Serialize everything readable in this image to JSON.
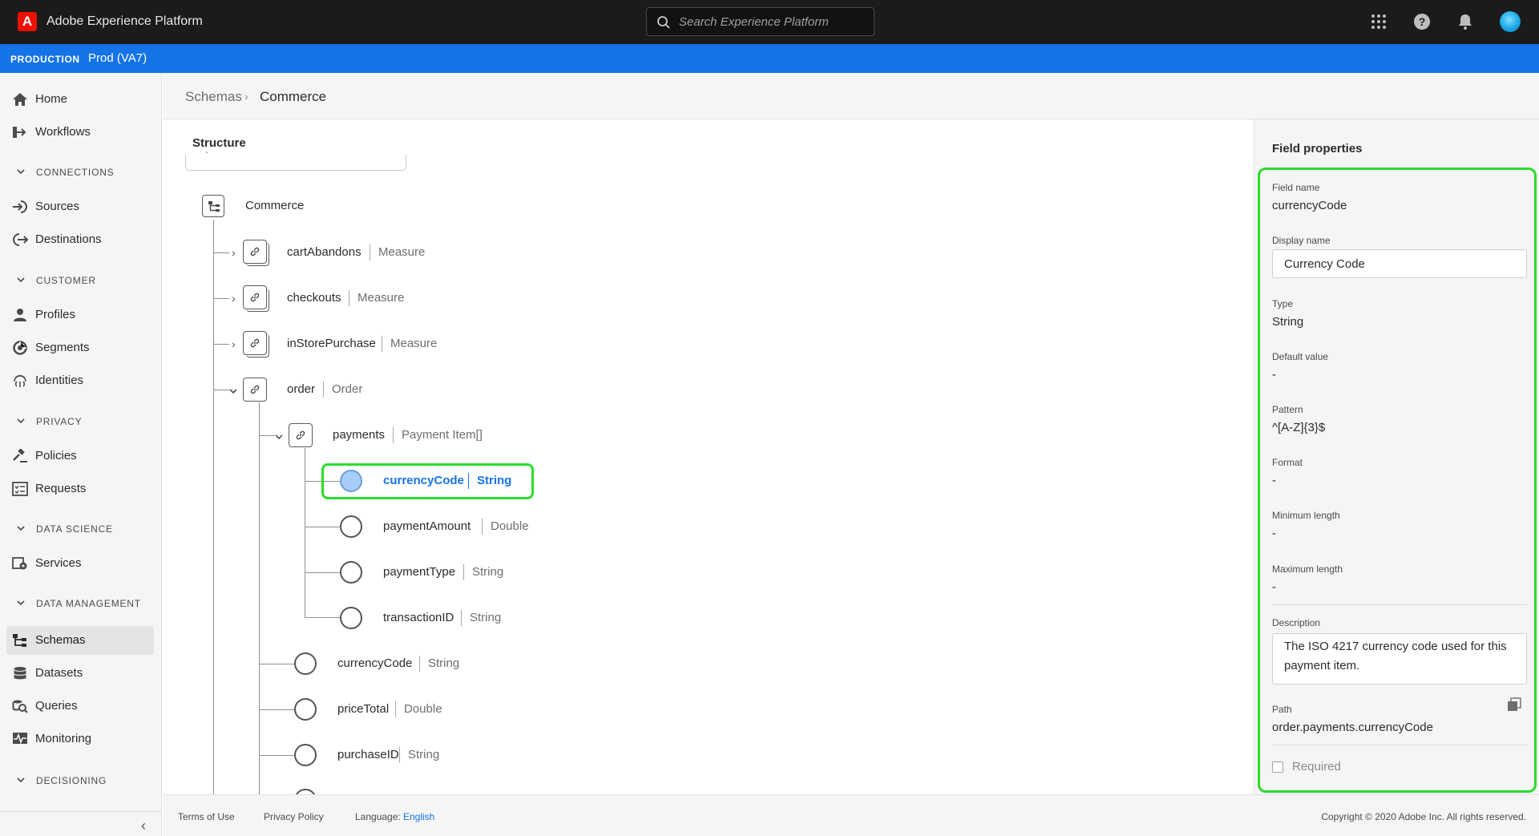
{
  "app": {
    "logo_letter": "A",
    "title": "Adobe Experience Platform"
  },
  "search": {
    "placeholder": "Search Experience Platform"
  },
  "env": {
    "label": "PRODUCTION",
    "name": "Prod (VA7)"
  },
  "sidebar": {
    "items": [
      {
        "label": "Home"
      },
      {
        "label": "Workflows"
      },
      {
        "section": "CONNECTIONS"
      },
      {
        "label": "Sources"
      },
      {
        "label": "Destinations"
      },
      {
        "section": "CUSTOMER"
      },
      {
        "label": "Profiles"
      },
      {
        "label": "Segments"
      },
      {
        "label": "Identities"
      },
      {
        "section": "PRIVACY"
      },
      {
        "label": "Policies"
      },
      {
        "label": "Requests"
      },
      {
        "section": "DATA SCIENCE"
      },
      {
        "label": "Services"
      },
      {
        "section": "DATA MANAGEMENT"
      },
      {
        "label": "Schemas",
        "active": true
      },
      {
        "label": "Datasets"
      },
      {
        "label": "Queries"
      },
      {
        "label": "Monitoring"
      },
      {
        "section": "DECISIONING"
      }
    ]
  },
  "breadcrumb": {
    "parent": "Schemas",
    "separator": "›",
    "current": "Commerce"
  },
  "structure": {
    "title": "Structure",
    "filter_fragment": "`",
    "root": "Commerce",
    "nodes": [
      {
        "name": "cartAbandons",
        "type": "Measure"
      },
      {
        "name": "checkouts",
        "type": "Measure"
      },
      {
        "name": "inStorePurchase",
        "type": "Measure"
      },
      {
        "name": "order",
        "type": "Order"
      },
      {
        "name": "payments",
        "type": "Payment Item[]"
      },
      {
        "name": "currencyCode",
        "type": "String",
        "selected": true
      },
      {
        "name": "paymentAmount",
        "type": "Double"
      },
      {
        "name": "paymentType",
        "type": "String"
      },
      {
        "name": "transactionID",
        "type": "String"
      },
      {
        "name": "currencyCode",
        "type": "String"
      },
      {
        "name": "priceTotal",
        "type": "Double"
      },
      {
        "name": "purchaseID",
        "type": "String"
      }
    ]
  },
  "field_properties": {
    "title": "Field properties",
    "field_name_label": "Field name",
    "field_name": "currencyCode",
    "display_name_label": "Display name",
    "display_name": "Currency Code",
    "type_label": "Type",
    "type": "String",
    "default_value_label": "Default value",
    "default_value": "-",
    "pattern_label": "Pattern",
    "pattern": "^[A-Z]{3}$",
    "format_label": "Format",
    "format": "-",
    "min_length_label": "Minimum length",
    "min_length": "-",
    "max_length_label": "Maximum length",
    "max_length": "-",
    "description_label": "Description",
    "description": "The ISO 4217 currency code used for this payment item.",
    "path_label": "Path",
    "path": "order.payments.currencyCode",
    "required_label": "Required",
    "required": false
  },
  "footer": {
    "terms": "Terms of Use",
    "privacy": "Privacy Policy",
    "language_label": "Language:",
    "language_value": "English",
    "copyright": "Copyright ©  2020 Adobe Inc.  All rights reserved."
  },
  "colors": {
    "accent": "#1473e6",
    "highlight": "#2bdc2b",
    "topbar": "#1b1b1b"
  }
}
